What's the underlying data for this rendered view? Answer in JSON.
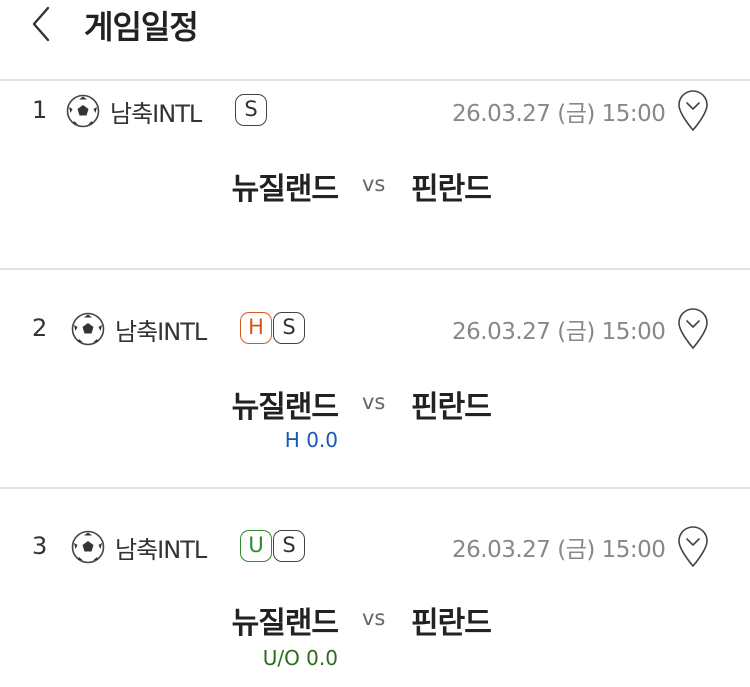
{
  "header": {
    "title": "게임일정"
  },
  "matches": [
    {
      "num": "1",
      "league": "남축INTL",
      "badges": [
        "S"
      ],
      "datetime": "26.03.27 (금) 15:00",
      "home": "뉴질랜드",
      "vs": "vs",
      "away": "핀란드",
      "extra": ""
    },
    {
      "num": "2",
      "league": "남축INTL",
      "badges": [
        "H",
        "S"
      ],
      "datetime": "26.03.27 (금) 15:00",
      "home": "뉴질랜드",
      "vs": "vs",
      "away": "핀란드",
      "extra": "H 0.0"
    },
    {
      "num": "3",
      "league": "남축INTL",
      "badges": [
        "U",
        "S"
      ],
      "datetime": "26.03.27 (금) 15:00",
      "home": "뉴질랜드",
      "vs": "vs",
      "away": "핀란드",
      "extra": "U/O 0.0"
    }
  ],
  "icons": {
    "back": "chevron-left-icon",
    "sport": "soccer-ball-icon",
    "location": "map-pin-icon"
  },
  "colors": {
    "handicap_badge": "#d35a1e",
    "overunder_badge": "#2e8b2e",
    "handicap_text": "#1b56b8",
    "overunder_text": "#2a6e1b"
  }
}
